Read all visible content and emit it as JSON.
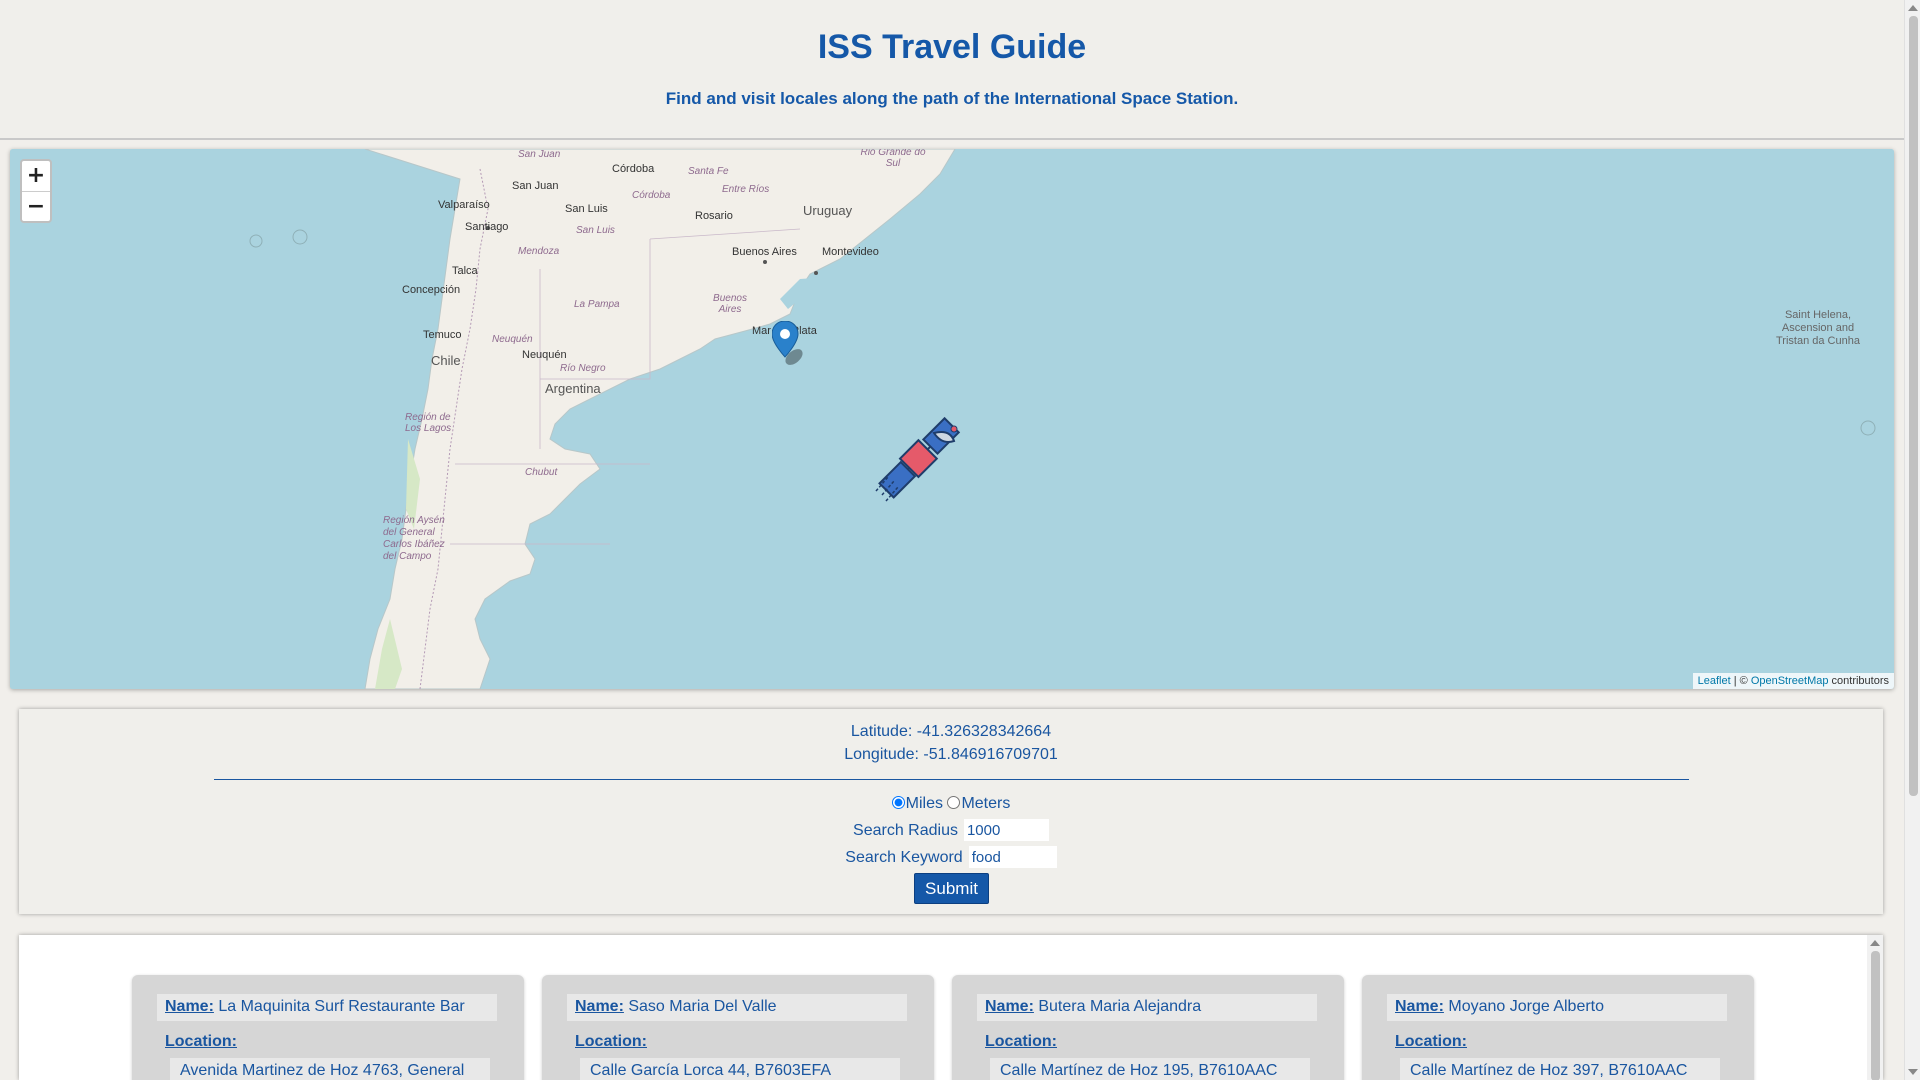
{
  "header": {
    "title": "ISS Travel Guide",
    "subtitle": "Find and visit locales along the path of the International Space Station."
  },
  "map": {
    "zoom_in": "+",
    "zoom_out": "−",
    "attribution": {
      "leaflet": "Leaflet",
      "sep": " | © ",
      "osm": "OpenStreetMap",
      "contributors": " contributors"
    },
    "labels": {
      "cordoba": "Córdoba",
      "san_juan_region": "San Juan",
      "san_juan": "San Juan",
      "santa_fe": "Santa Fe",
      "rio_grande": "Rio Grande do Sul",
      "cordoba_region": "Córdoba",
      "entre_rios": "Entre Ríos",
      "valparaiso": "Valparaíso",
      "san_luis": "San Luis",
      "uruguay": "Uruguay",
      "rosario": "Rosario",
      "santiago": "Santiago",
      "san_luis_region": "San Luis",
      "mendoza": "Mendoza",
      "buenos_aires": "Buenos Aires",
      "montevideo": "Montevideo",
      "talca": "Talca",
      "la_pampa": "La Pampa",
      "concepcion": "Concepción",
      "buenos_aires_region": "Buenos Aires",
      "mar_del_plata": "Mar del Plata",
      "temuco": "Temuco",
      "neuquen_region": "Neuquén",
      "neuquen": "Neuquén",
      "chile": "Chile",
      "rio_negro": "Río Negro",
      "argentina": "Argentina",
      "region_lagos": "Región de Los Lagos",
      "chubut": "Chubut",
      "region_aysen": "Región Aysén del General Carlos Ibáñez del Campo",
      "saint_helena": "Saint Helena, Ascension and Tristan da Cunha"
    }
  },
  "position": {
    "latitude_label": "Latitude: ",
    "latitude": "-41.326328342664",
    "longitude_label": "Longitude: ",
    "longitude": "-51.846916709701"
  },
  "form": {
    "unit_miles": "Miles",
    "unit_meters": "Meters",
    "selected_unit": "Miles",
    "radius_label": "Search Radius",
    "radius_value": "1000",
    "keyword_label": "Search Keyword",
    "keyword_value": "food",
    "submit_label": "Submit"
  },
  "results": {
    "name_key": "Name:",
    "location_key": "Location:",
    "items": [
      {
        "name": "La Maquinita Surf Restaurante Bar",
        "location": "Avenida Martinez de Hoz 4763, General"
      },
      {
        "name": "Saso Maria Del Valle",
        "location": "Calle García Lorca 44, B7603EFA"
      },
      {
        "name": "Butera Maria Alejandra",
        "location": "Calle Martínez de Hoz 195, B7610AAC"
      },
      {
        "name": "Moyano Jorge Alberto",
        "location": "Calle Martínez de Hoz 397, B7610AAC"
      }
    ]
  },
  "icons": {
    "map_pin": "map-marker-icon",
    "satellite": "satellite-icon"
  },
  "colors": {
    "primary": "#1558a8",
    "ocean": "#aad3df",
    "land": "#f2efe9",
    "panel": "#f0efeb"
  }
}
